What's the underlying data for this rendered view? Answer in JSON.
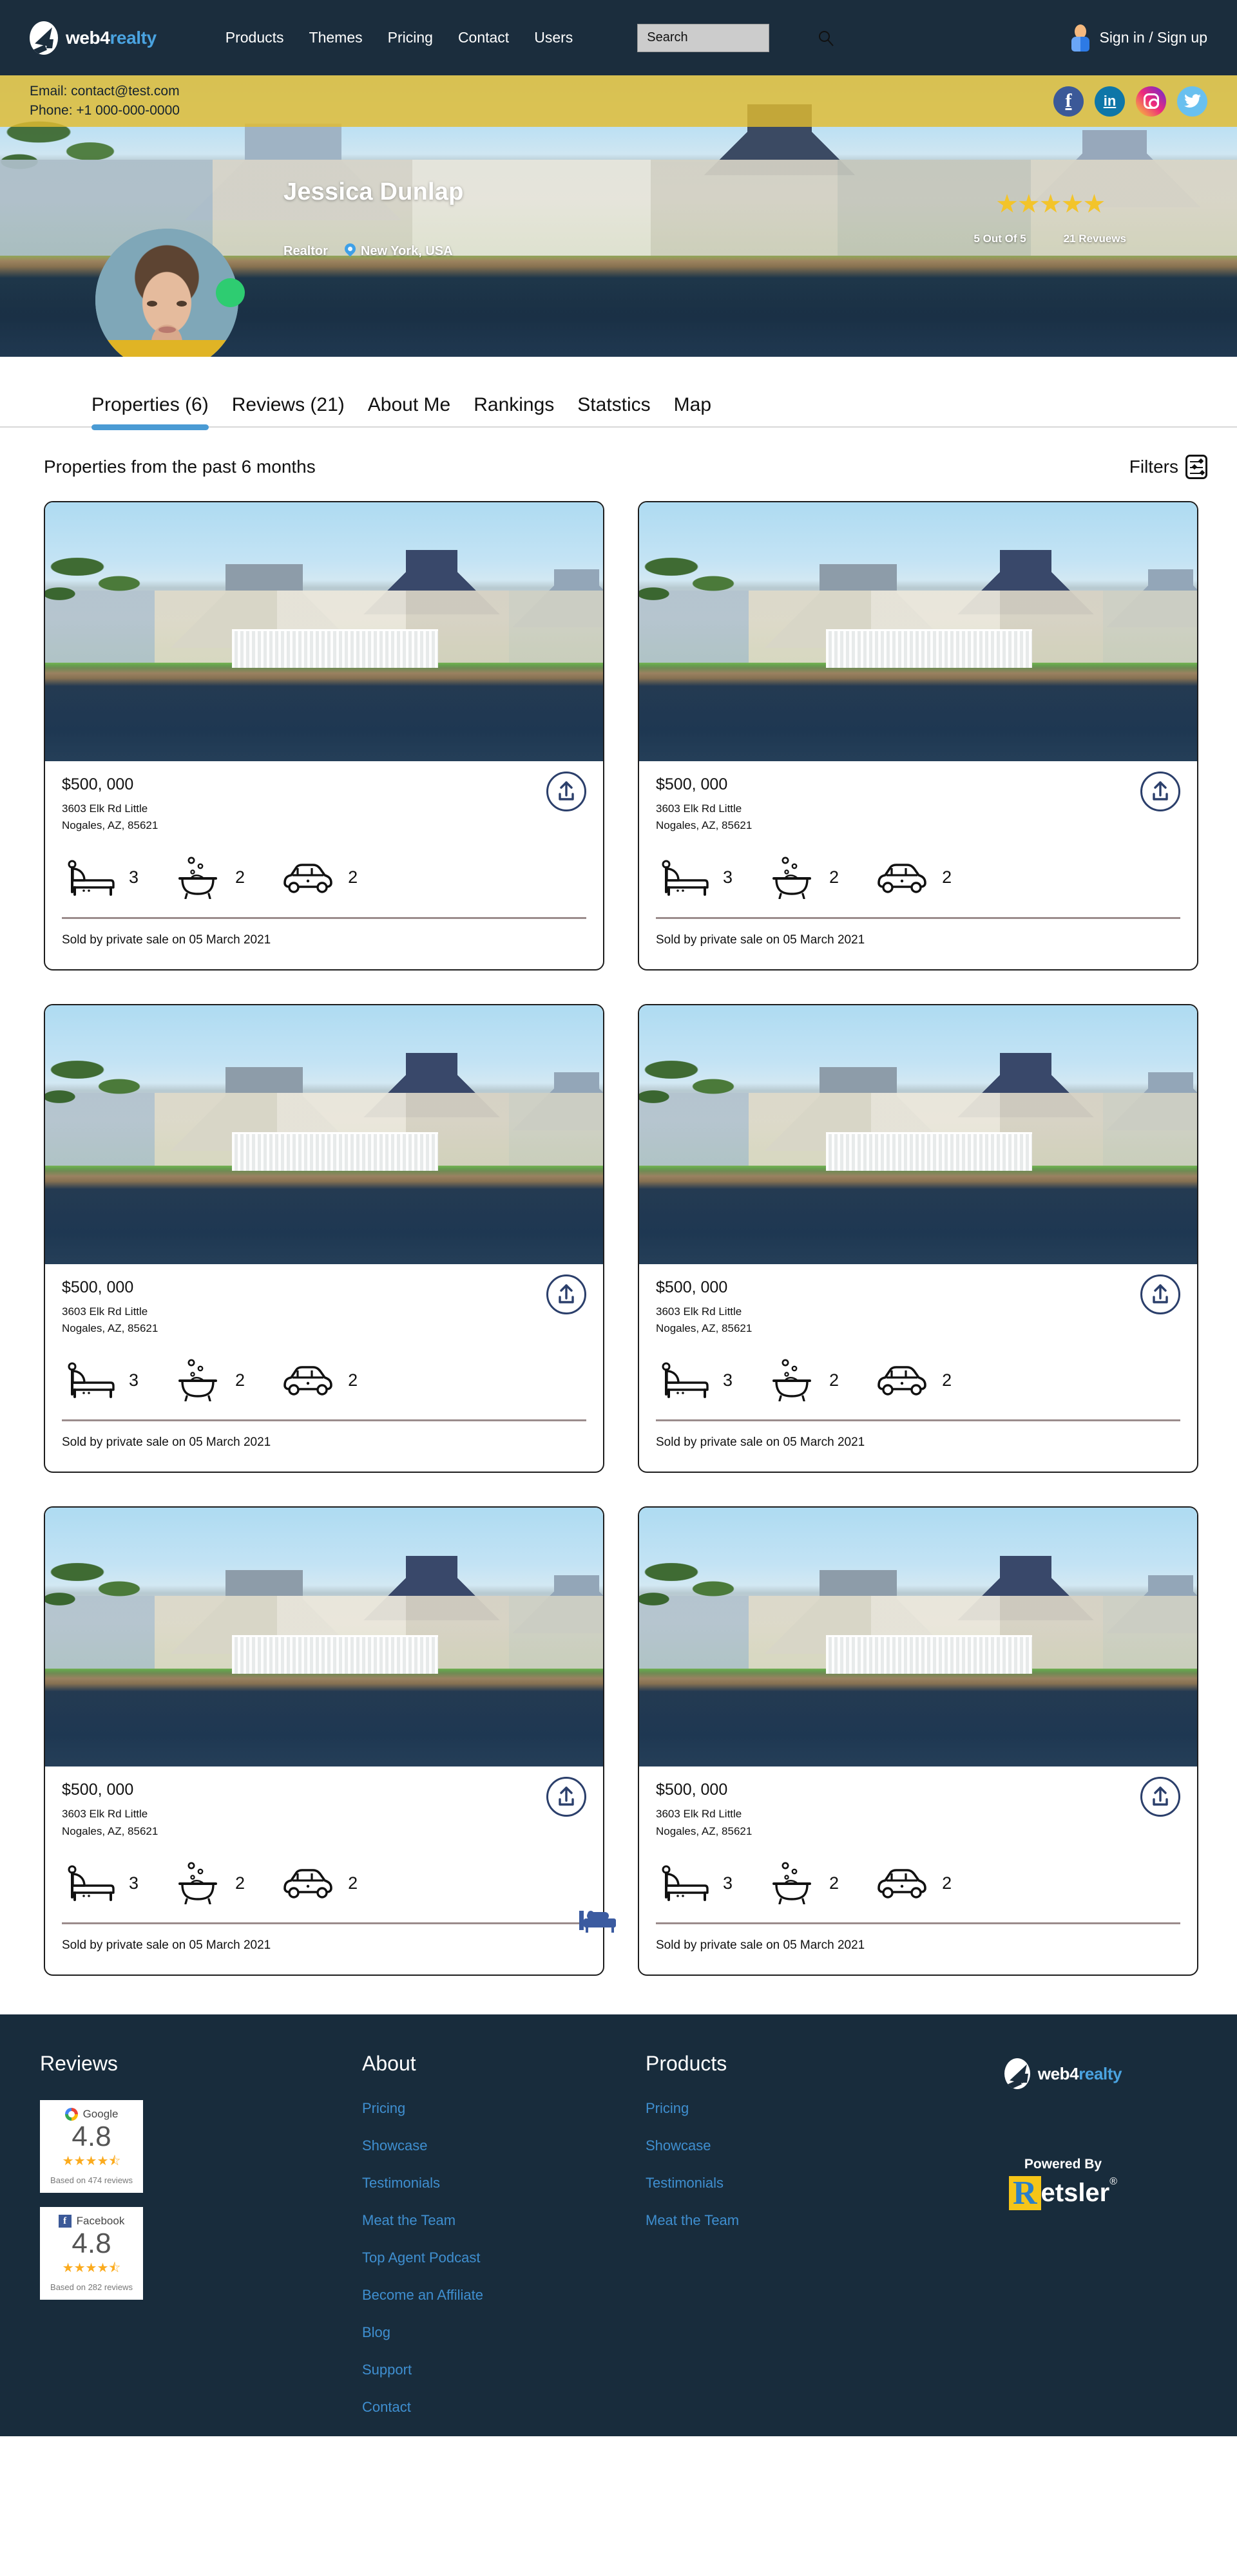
{
  "brand": {
    "part1": "web4",
    "part2": "realty",
    "logo_icon": "web4realty-logo-icon"
  },
  "topnav": {
    "links": [
      "Products",
      "Themes",
      "Pricing",
      "Contact",
      "Users"
    ],
    "search": {
      "placeholder": "Search",
      "value": "",
      "icon": "search-icon"
    },
    "signin_label": "Sign in / Sign up",
    "user_icon": "user-avatar-icon"
  },
  "contactbar": {
    "email": "Email: contact@test.com",
    "phone": "Phone: +1 000-000-0000",
    "socials": [
      {
        "name": "facebook-icon",
        "glyph": "f"
      },
      {
        "name": "linkedin-icon",
        "glyph": "in"
      },
      {
        "name": "instagram-icon",
        "glyph": ""
      },
      {
        "name": "twitter-icon",
        "glyph": "ᵥ"
      }
    ]
  },
  "hero": {
    "agent_name": "Jessica Dunlap",
    "agent_role": "Realtor",
    "agent_location": "New York, USA",
    "location_icon": "map-pin-icon",
    "online_status_icon": "online-status-dot",
    "avatar_icon": "agent-avatar",
    "stars": "★★★★★",
    "rating_text": "5 Out  Of 5",
    "reviews_text": "21 Revuews"
  },
  "tabs": [
    {
      "label": "Properties (6)",
      "active": true
    },
    {
      "label": "Reviews (21)",
      "active": false
    },
    {
      "label": "About Me",
      "active": false
    },
    {
      "label": "Rankings",
      "active": false
    },
    {
      "label": "Statstics",
      "active": false
    },
    {
      "label": "Map",
      "active": false
    }
  ],
  "section": {
    "title": "Properties from the past 6 months",
    "filters_label": "Filters",
    "filters_icon": "filter-sliders-icon"
  },
  "properties": [
    {
      "price": "$500, 000",
      "address_line1": "3603  Elk Rd Little",
      "address_line2": "Nogales, AZ, 85621",
      "beds": "3",
      "baths": "2",
      "cars": "2",
      "sold": "Sold by private sale on 05 March 2021",
      "share_icon": "share-upload-icon",
      "bed_icon": "bed-icon",
      "bath_icon": "bathtub-icon",
      "car_icon": "car-icon"
    },
    {
      "price": "$500, 000",
      "address_line1": "3603  Elk Rd Little",
      "address_line2": "Nogales, AZ, 85621",
      "beds": "3",
      "baths": "2",
      "cars": "2",
      "sold": "Sold by private sale on 05 March 2021",
      "share_icon": "share-upload-icon",
      "bed_icon": "bed-icon",
      "bath_icon": "bathtub-icon",
      "car_icon": "car-icon"
    },
    {
      "price": "$500, 000",
      "address_line1": "3603  Elk Rd Little",
      "address_line2": "Nogales, AZ, 85621",
      "beds": "3",
      "baths": "2",
      "cars": "2",
      "sold": "Sold by private sale on 05 March 2021",
      "share_icon": "share-upload-icon",
      "bed_icon": "bed-icon",
      "bath_icon": "bathtub-icon",
      "car_icon": "car-icon"
    },
    {
      "price": "$500, 000",
      "address_line1": "3603  Elk Rd Little",
      "address_line2": "Nogales, AZ, 85621",
      "beds": "3",
      "baths": "2",
      "cars": "2",
      "sold": "Sold by private sale on 05 March 2021",
      "share_icon": "share-upload-icon",
      "bed_icon": "bed-icon",
      "bath_icon": "bathtub-icon",
      "car_icon": "car-icon"
    },
    {
      "price": "$500, 000",
      "address_line1": "3603  Elk Rd Little",
      "address_line2": "Nogales, AZ, 85621",
      "beds": "3",
      "baths": "2",
      "cars": "2",
      "sold": "Sold by private sale on 05 March 2021",
      "share_icon": "share-upload-icon",
      "bed_icon": "bed-icon",
      "bath_icon": "bathtub-icon",
      "car_icon": "car-icon"
    },
    {
      "price": "$500, 000",
      "address_line1": "3603  Elk Rd Little",
      "address_line2": "Nogales, AZ, 85621",
      "beds": "3",
      "baths": "2",
      "cars": "2",
      "sold": "Sold by private sale on 05 March 2021",
      "share_icon": "share-upload-icon",
      "bed_icon": "bed-icon",
      "bath_icon": "bathtub-icon",
      "car_icon": "car-icon"
    }
  ],
  "footer": {
    "reviews": {
      "title": "Reviews",
      "cards": [
        {
          "source": "Google",
          "logo_icon": "google-logo-icon",
          "score": "4.8",
          "stars": "★★★★⯪",
          "based": "Based on 474 reviews"
        },
        {
          "source": "Facebook",
          "logo_icon": "facebook-logo-icon",
          "score": "4.8",
          "stars": "★★★★⯪",
          "based": "Based on 282 reviews"
        }
      ]
    },
    "about": {
      "title": "About",
      "links": [
        "Pricing",
        "Showcase",
        "Testimonials",
        "Meat the Team",
        "Top Agent Podcast",
        "Become an Affiliate",
        "Blog",
        "Support",
        "Contact"
      ]
    },
    "products": {
      "title": "Products",
      "links": [
        "Pricing",
        "Showcase",
        "Testimonials",
        "Meat the Team"
      ]
    },
    "powered_by_label": "Powered By",
    "powered_brand_r": "R",
    "powered_brand_rest": "etsler",
    "powered_brand_reg": "®"
  },
  "colors": {
    "nav_bg": "#1b2d3d",
    "accent_blue": "#4aa3e0",
    "contact_yellow": "#e2bc2f",
    "tab_underline": "#4a9bd4",
    "footer_bg": "#182c3c",
    "footer_link": "#3f8fd0",
    "star_yellow": "#f3c42a",
    "online_green": "#2ecc71",
    "share_icon_blue": "#2b3f6b"
  }
}
